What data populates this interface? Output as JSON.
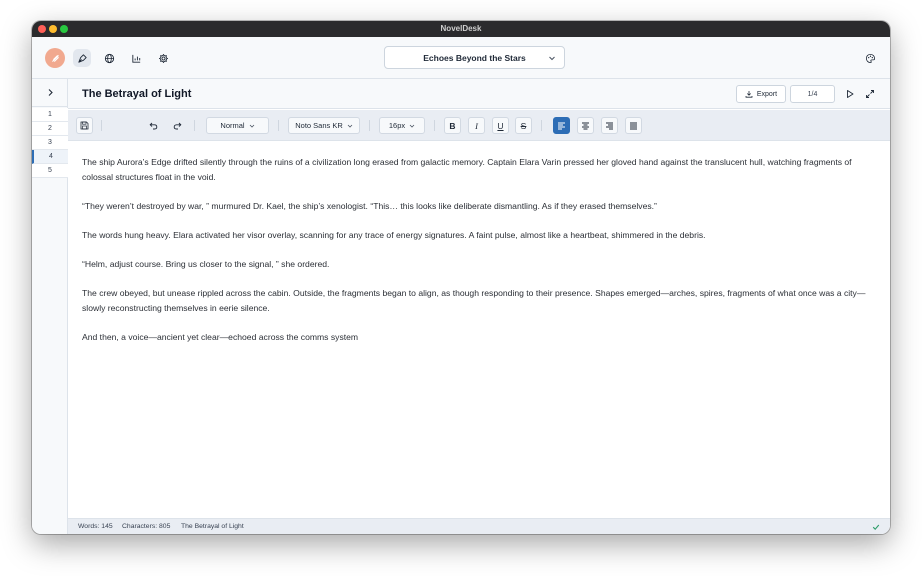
{
  "app": {
    "title": "NovelDesk"
  },
  "header": {
    "document_title": "Echoes Beyond the Stars"
  },
  "sidebar": {
    "chapters": [
      {
        "label": "1"
      },
      {
        "label": "2"
      },
      {
        "label": "3"
      },
      {
        "label": "4"
      },
      {
        "label": "5"
      }
    ],
    "active_index": 3
  },
  "chapter": {
    "title": "The Betrayal of Light",
    "export_label": "Export",
    "page_indicator": "1/4"
  },
  "toolbar": {
    "style_value": "Normal",
    "font_value": "Noto Sans KR",
    "size_value": "16px",
    "bold_label": "B",
    "italic_label": "I",
    "underline_label": "U",
    "strike_label": "S",
    "active_alignment": "left"
  },
  "content": {
    "paragraphs": [
      "The ship Aurora’s Edge drifted silently through the ruins of a civilization long erased from galactic memory. Captain Elara Varin pressed her gloved hand against the translucent hull, watching fragments of colossal structures float in the void.",
      "“They weren’t destroyed by war, ” murmured Dr. Kael, the ship’s xenologist. “This… this looks like deliberate dismantling. As if they erased themselves.”",
      "The words hung heavy. Elara activated her visor overlay, scanning for any trace of energy signatures. A faint pulse, almost like a heartbeat, shimmered in the debris.",
      "“Helm, adjust course. Bring us closer to the signal, ” she ordered.",
      "The crew obeyed, but unease rippled across the cabin. Outside, the fragments began to align, as though responding to their presence. Shapes emerged—arches, spires, fragments of what once was a city—slowly reconstructing themselves in eerie silence.",
      "And then, a voice—ancient yet clear—echoed across the comms system"
    ]
  },
  "status": {
    "words": "Words: 145",
    "characters": "Characters: 805",
    "chapter": "The Betrayal of Light"
  },
  "colors": {
    "accent": "#2d6db5",
    "logo": "#f1a98f",
    "status_ok": "#2e9e6a"
  }
}
